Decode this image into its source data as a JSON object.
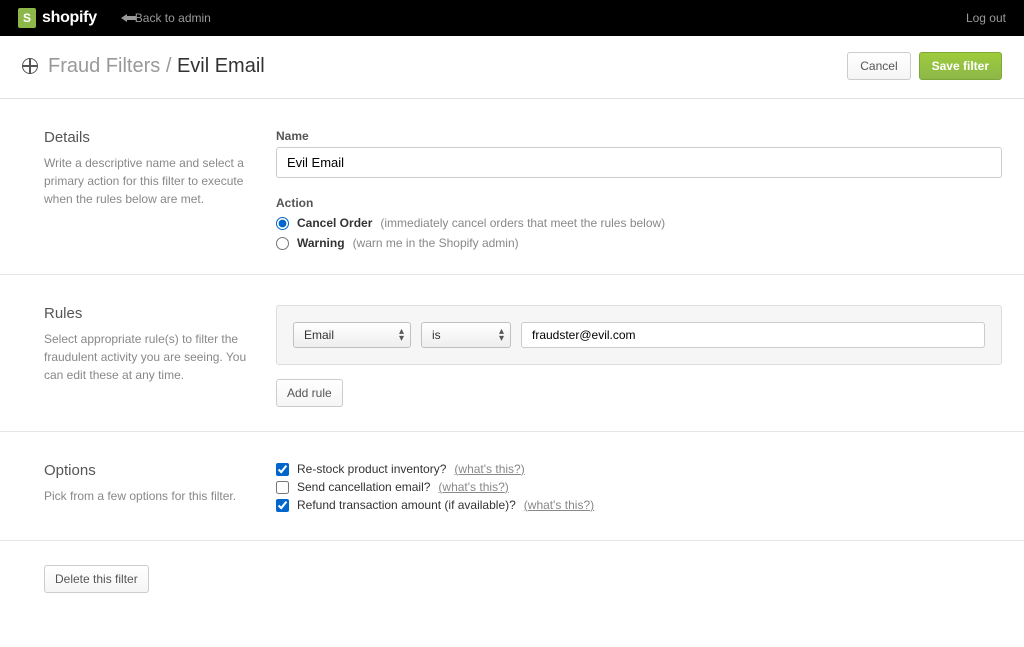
{
  "topbar": {
    "brand": "shopify",
    "back_label": "Back to admin",
    "logout": "Log out"
  },
  "header": {
    "breadcrumb_parent": "Fraud Filters",
    "breadcrumb_sep": "/",
    "breadcrumb_current": "Evil Email",
    "cancel": "Cancel",
    "save": "Save filter"
  },
  "details": {
    "title": "Details",
    "desc": "Write a descriptive name and select a primary action for this filter to execute when the rules below are met.",
    "name_label": "Name",
    "name_value": "Evil Email",
    "action_label": "Action",
    "action_cancel_name": "Cancel Order",
    "action_cancel_hint": "(immediately cancel orders that meet the rules below)",
    "action_warning_name": "Warning",
    "action_warning_hint": "(warn me in the Shopify admin)"
  },
  "rules": {
    "title": "Rules",
    "desc": "Select appropriate rule(s) to filter the fraudulent activity you are seeing. You can edit these at any time.",
    "field_select": "Email",
    "comparator_select": "is",
    "value": "fraudster@evil.com",
    "add_rule": "Add rule"
  },
  "options": {
    "title": "Options",
    "desc": "Pick from a few options for this filter.",
    "opt1": "Re-stock product inventory?",
    "opt2": "Send cancellation email?",
    "opt3": "Refund transaction amount (if available)?",
    "whats_this": "what's this?"
  },
  "footer": {
    "delete": "Delete this filter"
  }
}
